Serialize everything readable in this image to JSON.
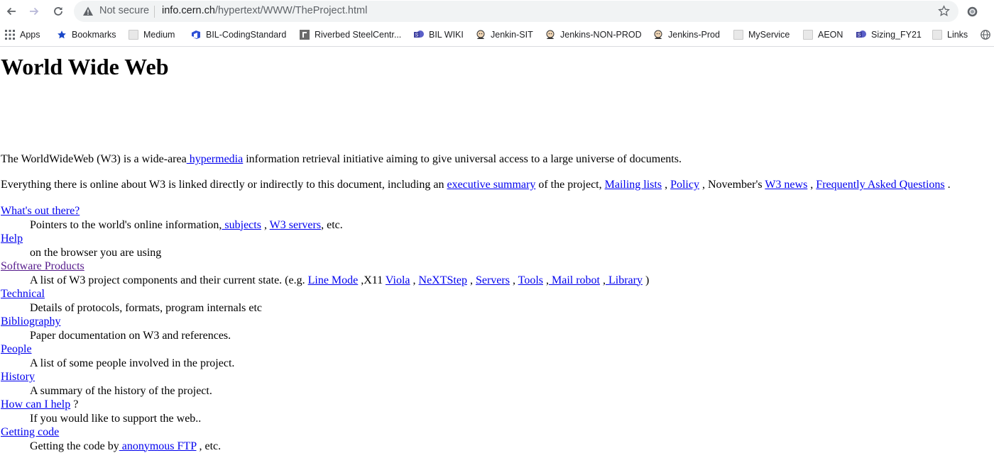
{
  "browser": {
    "security_label": "Not secure",
    "url_host": "info.cern.ch",
    "url_path": "/hypertext/WWW/TheProject.html",
    "bookmarks": [
      {
        "label": "Apps",
        "icon": "apps-grid-icon"
      },
      {
        "label": "Bookmarks",
        "icon": "star-icon"
      },
      {
        "label": "Medium",
        "icon": "page-icon"
      },
      {
        "label": "BIL-CodingStandard",
        "icon": "azure-devops-icon"
      },
      {
        "label": "Riverbed SteelCentr...",
        "icon": "riverbed-icon"
      },
      {
        "label": "BIL WIKI",
        "icon": "sharepoint-icon"
      },
      {
        "label": "Jenkin-SIT",
        "icon": "jenkins-icon"
      },
      {
        "label": "Jenkins-NON-PROD",
        "icon": "jenkins-icon"
      },
      {
        "label": "Jenkins-Prod",
        "icon": "jenkins-icon"
      },
      {
        "label": "MyService",
        "icon": "page-icon"
      },
      {
        "label": "AEON",
        "icon": "page-icon"
      },
      {
        "label": "Sizing_FY21",
        "icon": "sharepoint-icon"
      },
      {
        "label": "Links",
        "icon": "page-icon"
      }
    ]
  },
  "page": {
    "title": "World Wide Web",
    "intro": {
      "t1": "The WorldWideWeb (W3) is a wide-area",
      "link_hypermedia": " hypermedia",
      "t2": " information retrieval initiative aiming to give universal access to a large universe of documents."
    },
    "summary": {
      "t1": "Everything there is online about W3 is linked directly or indirectly to this document, including an ",
      "link_exec": "executive summary",
      "t2": " of the project, ",
      "link_mailing": "Mailing lists",
      "t3": " , ",
      "link_policy": "Policy",
      "t4": " , November's ",
      "link_news": "W3 news",
      "t5": " , ",
      "link_faq": "Frequently Asked Questions",
      "t6": " ."
    },
    "entries": {
      "whats_out": {
        "title": "What's out there?",
        "t1": "Pointers to the world's online information,",
        "link_subjects": " subjects",
        "t2": " , ",
        "link_servers": "W3 servers",
        "t3": ", etc."
      },
      "help": {
        "title": "Help",
        "desc": "on the browser you are using"
      },
      "software": {
        "title": "Software Products",
        "t1": "A list of W3 project components and their current state. (e.g. ",
        "link_linemode": "Line Mode",
        "t2": " ,X11 ",
        "link_viola": "Viola",
        "t3": " , ",
        "link_nextstep": "NeXTStep",
        "t4": " , ",
        "link_servers": "Servers",
        "t5": " , ",
        "link_tools": "Tools",
        "t6": " ,",
        "link_mailrobot": " Mail robot",
        "t7": " ,",
        "link_library": " Library",
        "t8": " )"
      },
      "technical": {
        "title": "Technical",
        "desc": "Details of protocols, formats, program internals etc"
      },
      "bibliography": {
        "title": "Bibliography",
        "desc": "Paper documentation on W3 and references."
      },
      "people": {
        "title": "People",
        "desc": "A list of some people involved in the project."
      },
      "history": {
        "title": "History",
        "desc": "A summary of the history of the project."
      },
      "howcanihelp": {
        "title": "How can I help",
        "suffix": " ?",
        "desc": "If you would like to support the web.."
      },
      "gettingcode": {
        "title": "Getting code",
        "t1": "Getting the code by",
        "link_ftp": " anonymous FTP",
        "t2": " , etc."
      }
    }
  },
  "colors": {
    "link": "#0000ee",
    "visited": "#551a8b",
    "omnibox_bg": "#f1f3f4"
  }
}
